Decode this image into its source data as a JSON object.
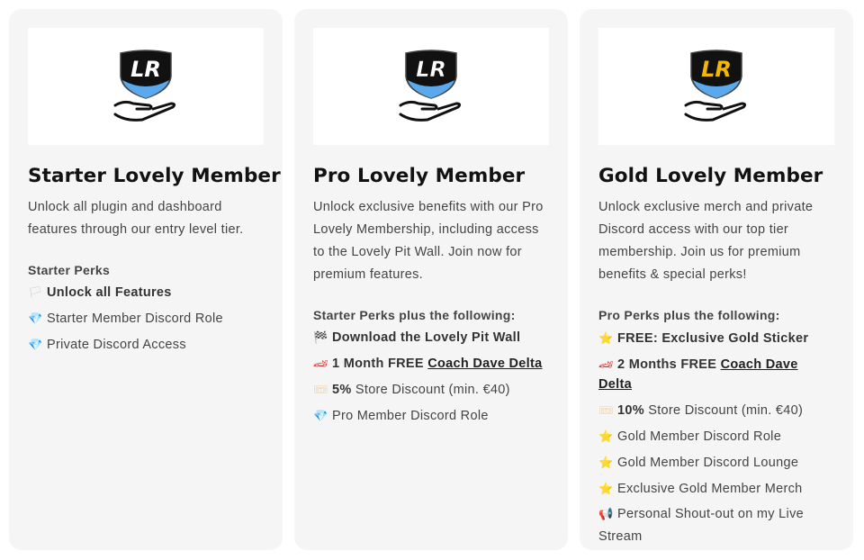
{
  "colors": {
    "card_bg": "#f5f5f5",
    "shield_black": "#111111",
    "blue_stripe": "#5aa9ec",
    "gold": "#f2b705"
  },
  "cards": [
    {
      "title": "Starter Lovely Member",
      "description": "Unlock all plugin and dashboard features through our entry level tier.",
      "perks_heading": "Starter Perks",
      "perks": [
        {
          "icon": "white-flag-icon",
          "glyph": "🏳",
          "bold": "Unlock all Features",
          "text": ""
        },
        {
          "icon": "gem-icon",
          "glyph": "💎",
          "bold": "",
          "text": "Starter Member Discord Role"
        },
        {
          "icon": "gem-icon",
          "glyph": "💎",
          "bold": "",
          "text": "Private Discord Access"
        }
      ]
    },
    {
      "title": "Pro Lovely Member",
      "description": "Unlock exclusive benefits with our Pro Lovely Membership, including access to the Lovely Pit Wall. Join now for premium features.",
      "perks_heading": "Starter Perks plus the following:",
      "perks": [
        {
          "icon": "checkered-flag-icon",
          "glyph": "🏁",
          "bold": "Download the Lovely Pit Wall",
          "text": ""
        },
        {
          "icon": "race-car-icon",
          "glyph": "🏎",
          "bold": "1 Month FREE ",
          "link": "Coach Dave Delta",
          "text": ""
        },
        {
          "icon": "ticket-icon",
          "glyph": "🎟",
          "bold": "5%",
          "text": " Store Discount (min. €40)"
        },
        {
          "icon": "gem-icon",
          "glyph": "💎",
          "bold": "",
          "text": "Pro Member Discord Role"
        }
      ]
    },
    {
      "title": "Gold Lovely Member",
      "description": "Unlock exclusive merch and private Discord access with our top tier membership. Join us for premium benefits & special perks!",
      "perks_heading": "Pro Perks plus the following:",
      "perks": [
        {
          "icon": "star-icon",
          "glyph": "⭐",
          "bold": "FREE: Exclusive Gold Sticker",
          "text": ""
        },
        {
          "icon": "race-car-icon",
          "glyph": "🏎",
          "bold": "2 Months FREE ",
          "link": "Coach Dave Delta",
          "text": ""
        },
        {
          "icon": "ticket-icon",
          "glyph": "🎟",
          "bold": "10%",
          "text": " Store Discount (min. €40)"
        },
        {
          "icon": "star-icon",
          "glyph": "⭐",
          "bold": "",
          "text": "Gold Member Discord Role"
        },
        {
          "icon": "star-icon",
          "glyph": "⭐",
          "bold": "",
          "text": "Gold Member Discord Lounge"
        },
        {
          "icon": "star-icon",
          "glyph": "⭐",
          "bold": "",
          "text": "Exclusive Gold Member Merch"
        },
        {
          "icon": "megaphone-icon",
          "glyph": "📢",
          "bold": "",
          "text": "Personal Shout-out on my Live Stream"
        }
      ]
    }
  ]
}
